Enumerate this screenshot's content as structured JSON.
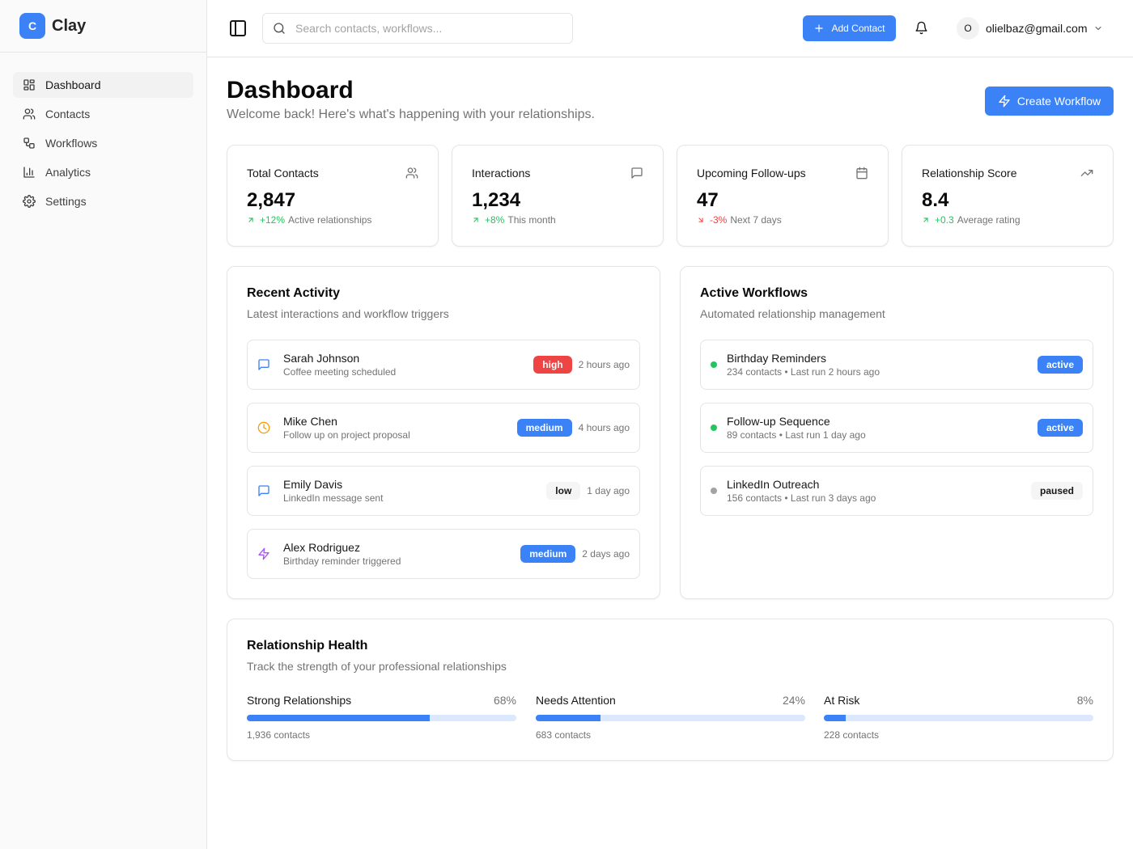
{
  "brand": {
    "logo_letter": "C",
    "name": "Clay"
  },
  "sidebar": {
    "items": [
      {
        "label": "Dashboard",
        "icon": "dashboard-icon",
        "active": true
      },
      {
        "label": "Contacts",
        "icon": "users-icon",
        "active": false
      },
      {
        "label": "Workflows",
        "icon": "workflow-icon",
        "active": false
      },
      {
        "label": "Analytics",
        "icon": "bar-chart-icon",
        "active": false
      },
      {
        "label": "Settings",
        "icon": "gear-icon",
        "active": false
      }
    ]
  },
  "header": {
    "search_placeholder": "Search contacts, workflows...",
    "add_contact_label": "Add Contact",
    "user_initial": "O",
    "user_email": "olielbaz@gmail.com"
  },
  "page": {
    "title": "Dashboard",
    "subtitle": "Welcome back! Here's what's happening with your relationships.",
    "create_workflow_label": "Create Workflow"
  },
  "stats": [
    {
      "label": "Total Contacts",
      "value": "2,847",
      "change": "+12%",
      "trend": "up",
      "note": "Active relationships",
      "icon": "users-icon"
    },
    {
      "label": "Interactions",
      "value": "1,234",
      "change": "+8%",
      "trend": "up",
      "note": "This month",
      "icon": "message-icon"
    },
    {
      "label": "Upcoming Follow-ups",
      "value": "47",
      "change": "-3%",
      "trend": "down",
      "note": "Next 7 days",
      "icon": "calendar-icon"
    },
    {
      "label": "Relationship Score",
      "value": "8.4",
      "change": "+0.3",
      "trend": "up",
      "note": "Average rating",
      "icon": "trending-up-icon"
    }
  ],
  "recent_activity": {
    "title": "Recent Activity",
    "subtitle": "Latest interactions and workflow triggers",
    "items": [
      {
        "name": "Sarah Johnson",
        "desc": "Coffee meeting scheduled",
        "priority": "high",
        "time": "2 hours ago",
        "icon": "message-icon"
      },
      {
        "name": "Mike Chen",
        "desc": "Follow up on project proposal",
        "priority": "medium",
        "time": "4 hours ago",
        "icon": "clock-icon"
      },
      {
        "name": "Emily Davis",
        "desc": "LinkedIn message sent",
        "priority": "low",
        "time": "1 day ago",
        "icon": "message-icon"
      },
      {
        "name": "Alex Rodriguez",
        "desc": "Birthday reminder triggered",
        "priority": "medium",
        "time": "2 days ago",
        "icon": "zap-icon"
      }
    ]
  },
  "active_workflows": {
    "title": "Active Workflows",
    "subtitle": "Automated relationship management",
    "items": [
      {
        "name": "Birthday Reminders",
        "desc": "234 contacts • Last run 2 hours ago",
        "status": "active"
      },
      {
        "name": "Follow-up Sequence",
        "desc": "89 contacts • Last run 1 day ago",
        "status": "active"
      },
      {
        "name": "LinkedIn Outreach",
        "desc": "156 contacts • Last run 3 days ago",
        "status": "paused"
      }
    ]
  },
  "relationship_health": {
    "title": "Relationship Health",
    "subtitle": "Track the strength of your professional relationships",
    "items": [
      {
        "name": "Strong Relationships",
        "pct_label": "68%",
        "fraction": 0.68,
        "count": "1,936 contacts"
      },
      {
        "name": "Needs Attention",
        "pct_label": "24%",
        "fraction": 0.24,
        "count": "683 contacts"
      },
      {
        "name": "At Risk",
        "pct_label": "8%",
        "fraction": 0.08,
        "count": "228 contacts"
      }
    ]
  },
  "colors": {
    "accent": "#3b82f6",
    "positive": "#22c55e",
    "negative": "#ef4444",
    "warning": "#f59e0b",
    "purple": "#a855f7",
    "status_active_dot": "#22c55e",
    "status_paused_dot": "#a3a3a3"
  }
}
